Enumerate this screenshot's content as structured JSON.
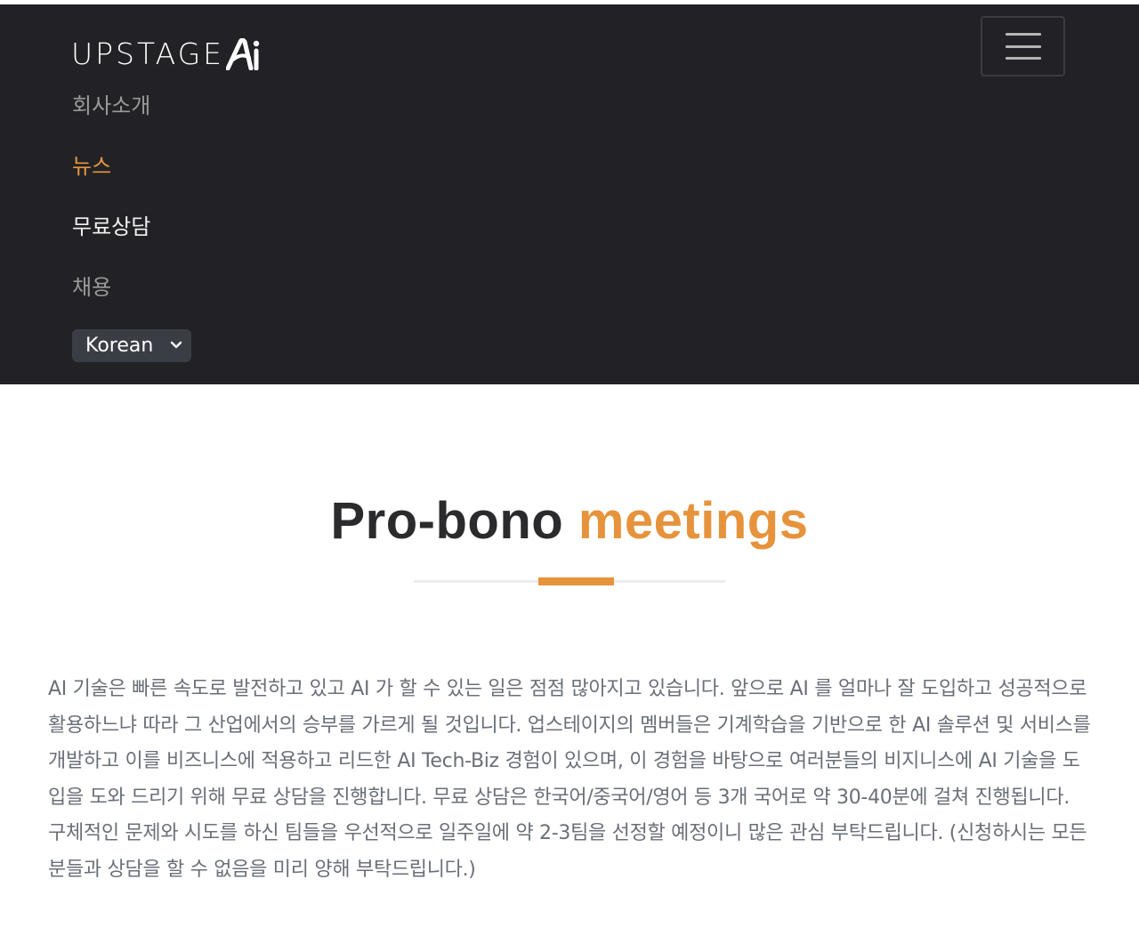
{
  "brand": {
    "logo_text": "UPSTAGE",
    "logo_mark_text": "Ai"
  },
  "navbar": {
    "items": [
      {
        "label": "회사소개"
      },
      {
        "label": "뉴스"
      },
      {
        "label": "무료상담"
      },
      {
        "label": "채용"
      }
    ],
    "language_select": {
      "value": "Korean"
    }
  },
  "colors": {
    "navbar_bg": "#222226",
    "accent": "#e6933c",
    "body_text": "#6a6f78"
  },
  "section": {
    "title_main": "Pro-bono",
    "title_accent": "meetings",
    "body": "AI 기술은 빠른 속도로 발전하고 있고 AI 가 할 수 있는 일은 점점 많아지고 있습니다. 앞으로 AI 를 얼마나 잘 도입하고 성공적으로 활용하느냐 따라 그 산업에서의 승부를 가르게 될 것입니다. 업스테이지의 멤버들은 기계학습을 기반으로 한 AI 솔루션 및 서비스를 개발하고 이를 비즈니스에 적용하고 리드한 AI Tech-Biz 경험이 있으며, 이 경험을 바탕으로 여러분들의 비지니스에 AI 기술을 도입을 도와 드리기 위해 무료 상담을 진행합니다. 무료 상담은 한국어/중국어/영어 등 3개 국어로 약 30-40분에 걸쳐 진행됩니다. 구체적인 문제와 시도를 하신 팀들을 우선적으로 일주일에 약 2-3팀을 선정할 예정이니 많은 관심 부탁드립니다. (신청하시는 모든 분들과 상담을 할 수 없음을 미리 양해 부탁드립니다.)"
  },
  "icons": {
    "menu": "hamburger-icon",
    "select": "chevron-down-icon"
  }
}
